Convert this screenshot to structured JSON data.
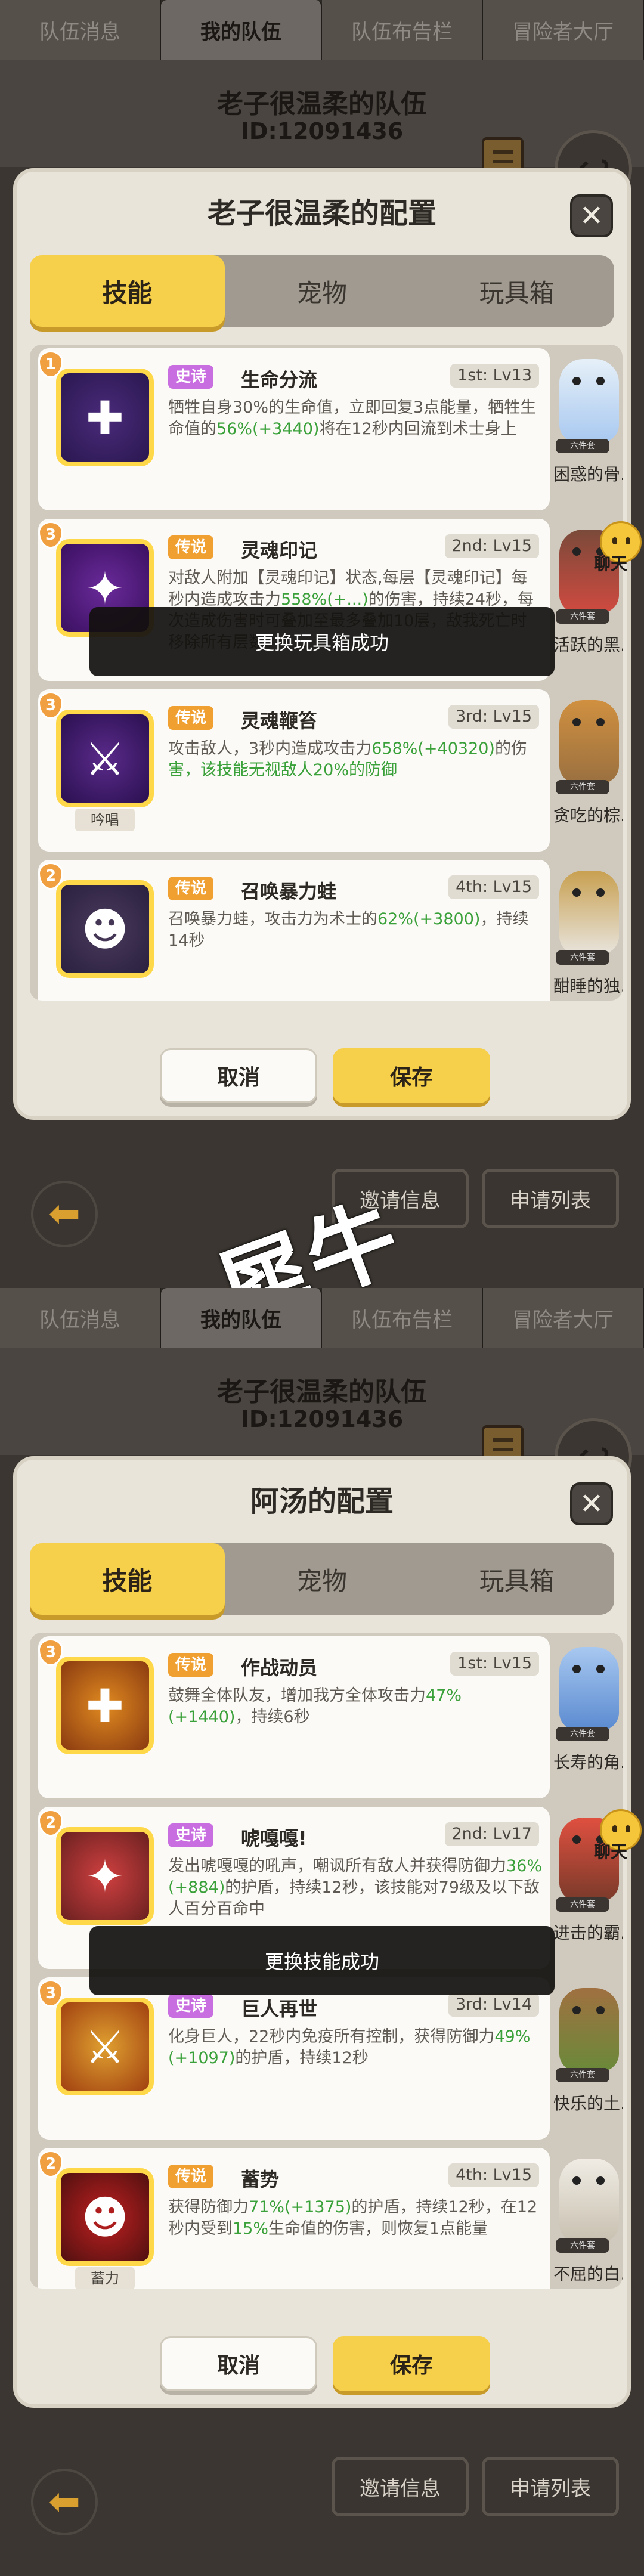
{
  "tabs": [
    "队伍消息",
    "我的队伍",
    "队伍布告栏",
    "冒险者大厅"
  ],
  "team_name": "老子很温柔的队伍",
  "team_id": "ID:12091436",
  "seg": [
    "技能",
    "宠物",
    "玩具箱"
  ],
  "buttons": {
    "cancel": "取消",
    "save": "保存",
    "invite": "邀请信息",
    "apply": "申请列表",
    "chat": "聊天"
  },
  "watermark": "犀牛",
  "screen1": {
    "title": "老子很温柔的配置",
    "toast": "更换玩具箱成功",
    "cards": [
      {
        "num": "1",
        "rarity": "史诗",
        "name": "生命分流",
        "slot": "1st: Lv13",
        "subtag": "",
        "desc": [
          "牺牲自身30%的生命值，立即回复3点能量，牺",
          "牲生命值的",
          "56%(+3440)",
          "将在12秒内回流到术士",
          "身上"
        ],
        "pet": "困惑的骨...",
        "pet_tag": "六件套"
      },
      {
        "num": "3",
        "rarity": "传说",
        "name": "灵魂印记",
        "slot": "2nd: Lv15",
        "subtag": "",
        "desc": [
          "对敌人附加【灵魂印记】状态,每层【灵魂印记】",
          "每秒内造成攻击力",
          "558%(+...)",
          "的伤害，持续24",
          "秒，每次造成伤害时可叠加至最多叠加10层，",
          "敌我死亡时移除所有层数"
        ],
        "pet": "活跃的黑...",
        "pet_tag": "六件套"
      },
      {
        "num": "3",
        "rarity": "传说",
        "name": "灵魂鞭笞",
        "slot": "3rd: Lv15",
        "subtag": "吟唱",
        "desc": [
          "攻击敌人，3秒内造成攻击力",
          "658%(+40320)",
          "的伤",
          "害，该技能无视敌人20%的防御"
        ],
        "pet": "贪吃的棕...",
        "pet_tag": "六件套"
      },
      {
        "num": "2",
        "rarity": "传说",
        "name": "召唤暴力蛙",
        "slot": "4th: Lv15",
        "subtag": "",
        "desc": [
          "召唤暴力蛙，攻击力为术士的",
          "62%(+3800)",
          "，持",
          "续14秒"
        ],
        "pet": "酣睡的独...",
        "pet_tag": "六件套"
      }
    ]
  },
  "screen2": {
    "title": "阿汤的配置",
    "toast": "更换技能成功",
    "cards": [
      {
        "num": "3",
        "rarity": "传说",
        "name": "作战动员",
        "slot": "1st: Lv15",
        "subtag": "",
        "desc": [
          "鼓舞全体队友，增加我方全体攻击力",
          "47%(+1440)",
          "，持续6秒"
        ],
        "pet": "长寿的角...",
        "pet_tag": "六件套"
      },
      {
        "num": "2",
        "rarity": "史诗",
        "name": "唬嘎嘎!",
        "slot": "2nd: Lv17",
        "subtag": "",
        "desc": [
          "发出唬嘎嘎的吼声，嘲讽所有敌人并获得防御力",
          "36%(+884)",
          "的护盾，持续12秒，该技能对79级及",
          "以下敌人百分百命中"
        ],
        "pet": "进击的霸...",
        "pet_tag": "六件套"
      },
      {
        "num": "3",
        "rarity": "史诗",
        "name": "巨人再世",
        "slot": "3rd: Lv14",
        "subtag": "",
        "desc": [
          "化身巨人，22秒内免疫所有控制，获得防御力",
          "49%(+1097)",
          "的护盾，持续12秒"
        ],
        "pet": "快乐的土...",
        "pet_tag": "六件套"
      },
      {
        "num": "2",
        "rarity": "传说",
        "name": "蓄势",
        "slot": "4th: Lv15",
        "subtag": "蓄力",
        "desc": [
          "获得防御力",
          "71%(+1375)",
          "的护盾，持续12秒，在12",
          "秒内受到",
          "15%",
          "生命值的伤害，则恢复1点能量"
        ],
        "pet": "不屈的白...",
        "pet_tag": "六件套"
      }
    ]
  },
  "colors": {
    "accent": "#f6d04a",
    "epic": "#c86ee0",
    "legend": "#f0a030",
    "green": "#3aa13a"
  }
}
